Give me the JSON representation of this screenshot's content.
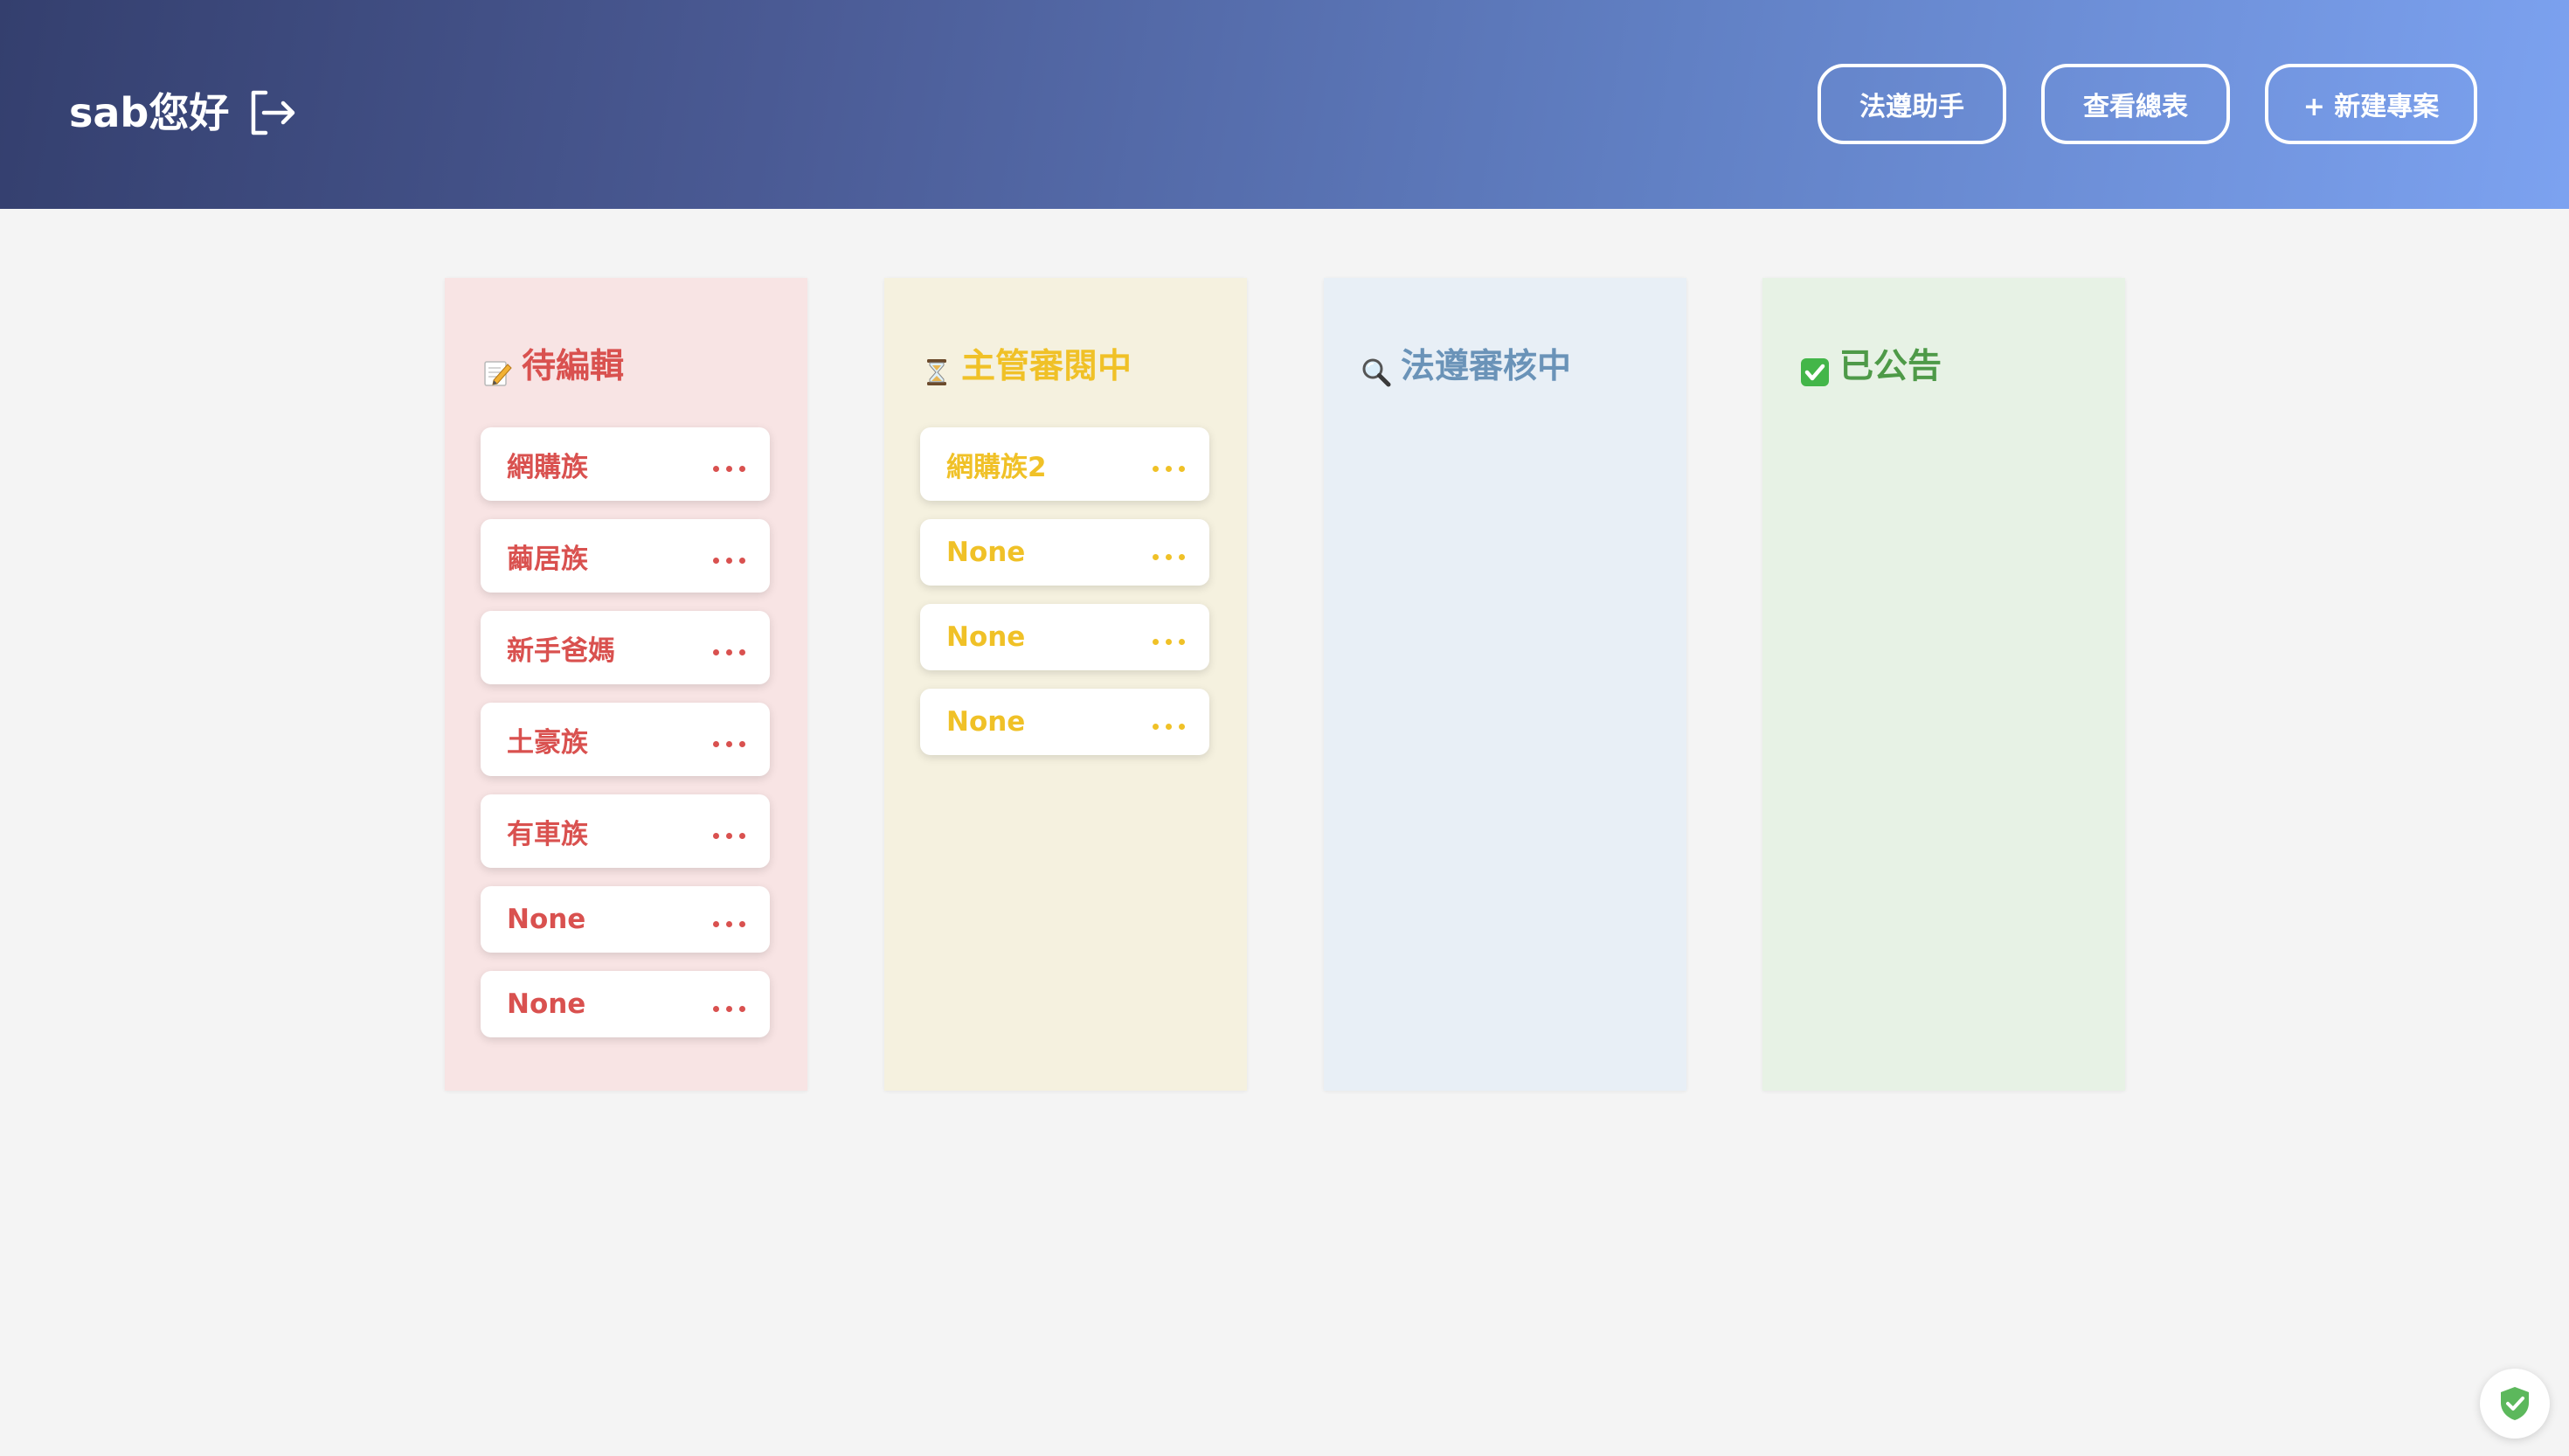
{
  "header": {
    "greeting": "sab您好",
    "logout_icon": "logout-icon",
    "buttons": [
      {
        "label": "法遵助手"
      },
      {
        "label": "查看總表"
      },
      {
        "label": "+ 新建專案"
      }
    ]
  },
  "board": {
    "columns": [
      {
        "title": "待編輯",
        "icon": "memo-icon",
        "bg": "#f8e4e4",
        "accent": "#d9514f",
        "cards": [
          "網購族",
          "繭居族",
          "新手爸媽",
          "土豪族",
          "有車族",
          "None",
          "None"
        ]
      },
      {
        "title": "主管審閱中",
        "icon": "hourglass-icon",
        "bg": "#f5f1df",
        "accent": "#f0c127",
        "cards": [
          "網購族2",
          "None",
          "None",
          "None"
        ]
      },
      {
        "title": "法遵審核中",
        "icon": "magnifier-icon",
        "bg": "#e8eff6",
        "accent": "#6a93b8",
        "cards": []
      },
      {
        "title": "已公告",
        "icon": "check-box-icon",
        "bg": "#e7f2e5",
        "accent": "#4e9a48",
        "cards": []
      }
    ]
  },
  "badge": {
    "icon": "shield-check-icon",
    "color": "#5cb85c"
  }
}
